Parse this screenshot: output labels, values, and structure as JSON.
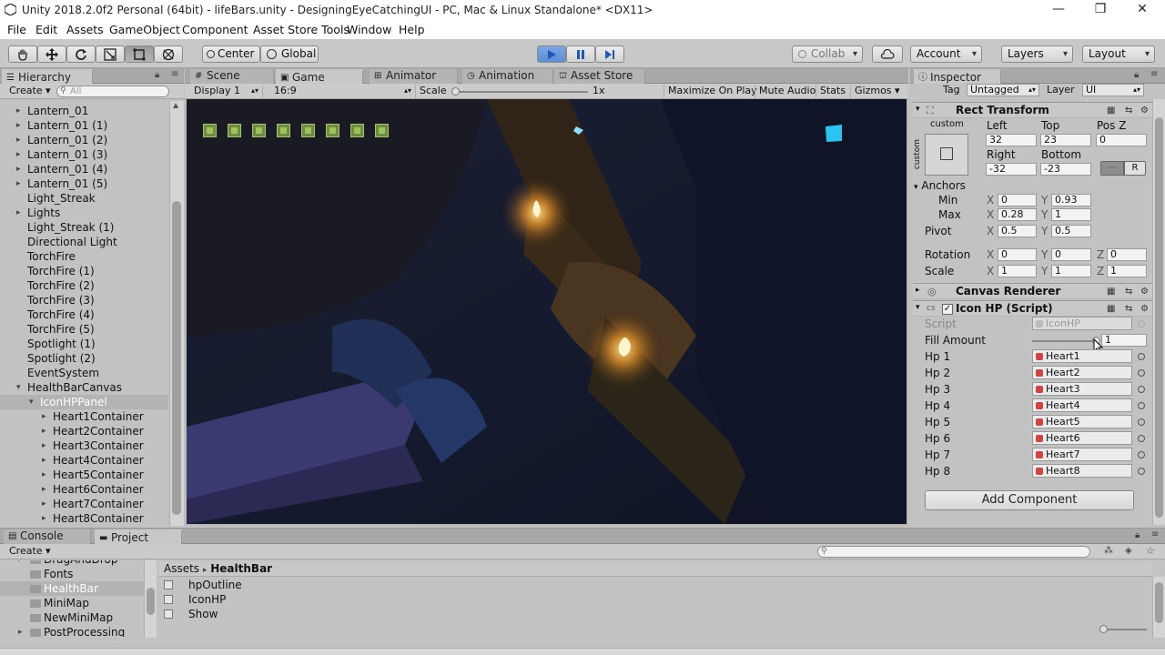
{
  "window": {
    "title": "Unity 2018.2.0f2 Personal (64bit) - lifeBars.unity - DesigningEyeCatchingUI - PC, Mac & Linux Standalone* <DX11>",
    "minimize": "—",
    "maximize": "❐",
    "close": "✕"
  },
  "menu": [
    "File",
    "Edit",
    "Assets",
    "GameObject",
    "Component",
    "Asset Store Tools",
    "Window",
    "Help"
  ],
  "toolbar": {
    "center": "Center",
    "global": "Global",
    "collab": "Collab",
    "account": "Account",
    "layers": "Layers",
    "layout": "Layout"
  },
  "hierarchy": {
    "tab": "Hierarchy",
    "create": "Create",
    "search_placeholder": "All",
    "items": [
      {
        "label": "Lantern_01",
        "indent": 0,
        "arrow": "▸"
      },
      {
        "label": "Lantern_01 (1)",
        "indent": 0,
        "arrow": "▸"
      },
      {
        "label": "Lantern_01 (2)",
        "indent": 0,
        "arrow": "▸"
      },
      {
        "label": "Lantern_01 (3)",
        "indent": 0,
        "arrow": "▸"
      },
      {
        "label": "Lantern_01 (4)",
        "indent": 0,
        "arrow": "▸"
      },
      {
        "label": "Lantern_01 (5)",
        "indent": 0,
        "arrow": "▸"
      },
      {
        "label": "Light_Streak",
        "indent": 0,
        "arrow": ""
      },
      {
        "label": "Lights",
        "indent": 0,
        "arrow": "▸"
      },
      {
        "label": "Light_Streak (1)",
        "indent": 0,
        "arrow": ""
      },
      {
        "label": "Directional Light",
        "indent": 0,
        "arrow": ""
      },
      {
        "label": "TorchFire",
        "indent": 0,
        "arrow": ""
      },
      {
        "label": "TorchFire (1)",
        "indent": 0,
        "arrow": ""
      },
      {
        "label": "TorchFire (2)",
        "indent": 0,
        "arrow": ""
      },
      {
        "label": "TorchFire (3)",
        "indent": 0,
        "arrow": ""
      },
      {
        "label": "TorchFire (4)",
        "indent": 0,
        "arrow": ""
      },
      {
        "label": "TorchFire (5)",
        "indent": 0,
        "arrow": ""
      },
      {
        "label": "Spotlight (1)",
        "indent": 0,
        "arrow": ""
      },
      {
        "label": "Spotlight (2)",
        "indent": 0,
        "arrow": ""
      },
      {
        "label": "EventSystem",
        "indent": 0,
        "arrow": ""
      },
      {
        "label": "HealthBarCanvas",
        "indent": 0,
        "arrow": "▾"
      },
      {
        "label": "IconHPPanel",
        "indent": 1,
        "arrow": "▾",
        "selected": true
      },
      {
        "label": "Heart1Container",
        "indent": 2,
        "arrow": "▸"
      },
      {
        "label": "Heart2Container",
        "indent": 2,
        "arrow": "▸"
      },
      {
        "label": "Heart3Container",
        "indent": 2,
        "arrow": "▸"
      },
      {
        "label": "Heart4Container",
        "indent": 2,
        "arrow": "▸"
      },
      {
        "label": "Heart5Container",
        "indent": 2,
        "arrow": "▸"
      },
      {
        "label": "Heart6Container",
        "indent": 2,
        "arrow": "▸"
      },
      {
        "label": "Heart7Container",
        "indent": 2,
        "arrow": "▸"
      },
      {
        "label": "Heart8Container",
        "indent": 2,
        "arrow": "▸"
      }
    ]
  },
  "center_tabs": [
    "Scene",
    "Game",
    "Animator",
    "Animation",
    "Asset Store"
  ],
  "game_bar": {
    "display": "Display 1",
    "aspect": "16:9",
    "scale_label": "Scale",
    "scale_value": "1x",
    "maximize": "Maximize On Play",
    "mute": "Mute Audio",
    "stats": "Stats",
    "gizmos": "Gizmos"
  },
  "inspector": {
    "tab": "Inspector",
    "tag_label": "Tag",
    "tag_value": "Untagged",
    "layer_label": "Layer",
    "layer_value": "UI",
    "rect_transform": {
      "title": "Rect Transform",
      "anchor_label": "custom",
      "anchor_side": "custom",
      "left_label": "Left",
      "left": "32",
      "top_label": "Top",
      "top": "23",
      "posz_label": "Pos Z",
      "posz": "0",
      "right_label": "Right",
      "right": "-32",
      "bottom_label": "Bottom",
      "bottom": "-23",
      "r_btn": "R",
      "anchors_label": "Anchors",
      "min_label": "Min",
      "min_x": "0",
      "min_y": "0.93",
      "max_label": "Max",
      "max_x": "0.28",
      "max_y": "1",
      "pivot_label": "Pivot",
      "pivot_x": "0.5",
      "pivot_y": "0.5",
      "rotation_label": "Rotation",
      "rot_x": "0",
      "rot_y": "0",
      "rot_z": "0",
      "scale_label": "Scale",
      "scale_x": "1",
      "scale_y": "1",
      "scale_z": "1",
      "x": "X",
      "y": "Y",
      "z": "Z"
    },
    "canvas_renderer": "Canvas Renderer",
    "icon_hp": {
      "title": "Icon HP (Script)",
      "script_label": "Script",
      "script_value": "IconHP",
      "fill_label": "Fill Amount",
      "fill_value": "1",
      "hp": [
        {
          "label": "Hp 1",
          "value": "Heart1"
        },
        {
          "label": "Hp 2",
          "value": "Heart2"
        },
        {
          "label": "Hp 3",
          "value": "Heart3"
        },
        {
          "label": "Hp 4",
          "value": "Heart4"
        },
        {
          "label": "Hp 5",
          "value": "Heart5"
        },
        {
          "label": "Hp 6",
          "value": "Heart6"
        },
        {
          "label": "Hp 7",
          "value": "Heart7"
        },
        {
          "label": "Hp 8",
          "value": "Heart8"
        }
      ]
    },
    "add_component": "Add Component"
  },
  "bottom": {
    "console_tab": "Console",
    "project_tab": "Project",
    "create": "Create",
    "folders": [
      {
        "label": "DragAndDrop",
        "selected": false
      },
      {
        "label": "Fonts",
        "selected": false
      },
      {
        "label": "HealthBar",
        "selected": true
      },
      {
        "label": "MiniMap",
        "selected": false
      },
      {
        "label": "NewMiniMap",
        "selected": false
      },
      {
        "label": "PostProcessing",
        "selected": false
      }
    ],
    "breadcrumb_root": "Assets",
    "breadcrumb_sep": "▸",
    "breadcrumb_current": "HealthBar",
    "assets": [
      "hpOutline",
      "IconHP",
      "Show"
    ]
  },
  "colors": {
    "play_accent": "#5c8ed6",
    "selection": "#b3b3b3",
    "hp_square": "#9fc25b"
  }
}
